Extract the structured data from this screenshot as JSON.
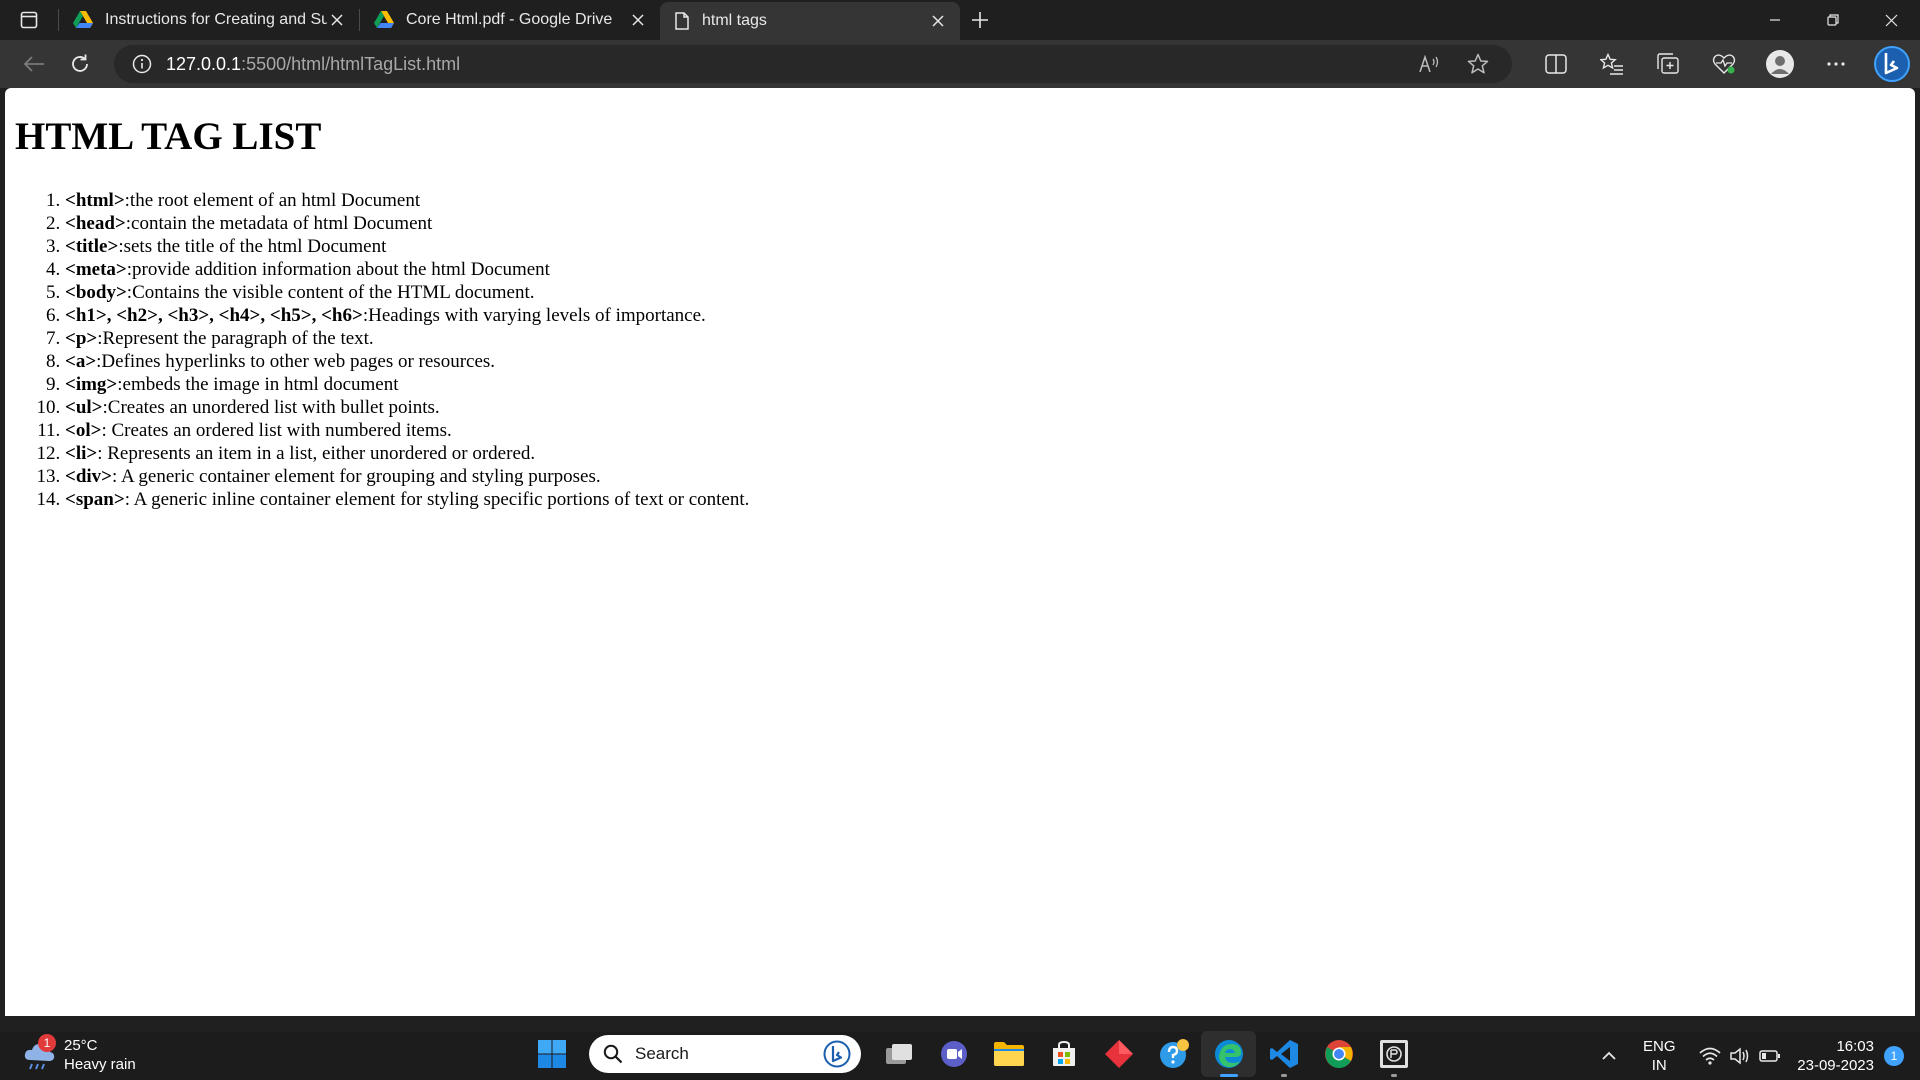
{
  "tabs": [
    {
      "title": "Instructions for Creating and Sub",
      "icon": "google-drive-icon",
      "active": false
    },
    {
      "title": "Core Html.pdf - Google Drive",
      "icon": "google-drive-icon",
      "active": false
    },
    {
      "title": "html tags",
      "icon": "page-icon",
      "active": true
    }
  ],
  "address": {
    "host": "127.0.0.1",
    "path": ":5500/html/htmlTagList.html"
  },
  "page": {
    "heading": "HTML TAG LIST",
    "items": [
      {
        "tag": "<html>",
        "desc": ":the root element of an html Document"
      },
      {
        "tag": "<head>",
        "desc": ":contain the metadata of html Document"
      },
      {
        "tag": "<title>",
        "desc": ":sets the title of the html Document"
      },
      {
        "tag": "<meta>",
        "desc": ":provide addition information about the html Document"
      },
      {
        "tag": "<body>",
        "desc": ":Contains the visible content of the HTML document."
      },
      {
        "tag": "<h1>, <h2>, <h3>, <h4>, <h5>, <h6>",
        "desc": ":Headings with varying levels of importance."
      },
      {
        "tag": "<p>",
        "desc": ":Represent the paragraph of the text."
      },
      {
        "tag": "<a>",
        "desc": ":Defines hyperlinks to other web pages or resources."
      },
      {
        "tag": "<img>",
        "desc": ":embeds the image in html document"
      },
      {
        "tag": "<ul>",
        "desc": ":Creates an unordered list with bullet points."
      },
      {
        "tag": "<ol>",
        "desc": ": Creates an ordered list with numbered items."
      },
      {
        "tag": "<li>",
        "desc": ": Represents an item in a list, either unordered or ordered."
      },
      {
        "tag": "<div>",
        "desc": ": A generic container element for grouping and styling purposes."
      },
      {
        "tag": "<span>",
        "desc": ": A generic inline container element for styling specific portions of text or content."
      }
    ]
  },
  "taskbar": {
    "weather": {
      "temp": "25°C",
      "condition": "Heavy rain",
      "badge": "1"
    },
    "search_placeholder": "Search",
    "lang_line1": "ENG",
    "lang_line2": "IN",
    "time": "16:03",
    "date": "23-09-2023",
    "notifications": "1"
  },
  "colors": {
    "accent": "#3fa3ff",
    "tab_active": "#353535",
    "tab_strip": "#1f1f1f"
  }
}
